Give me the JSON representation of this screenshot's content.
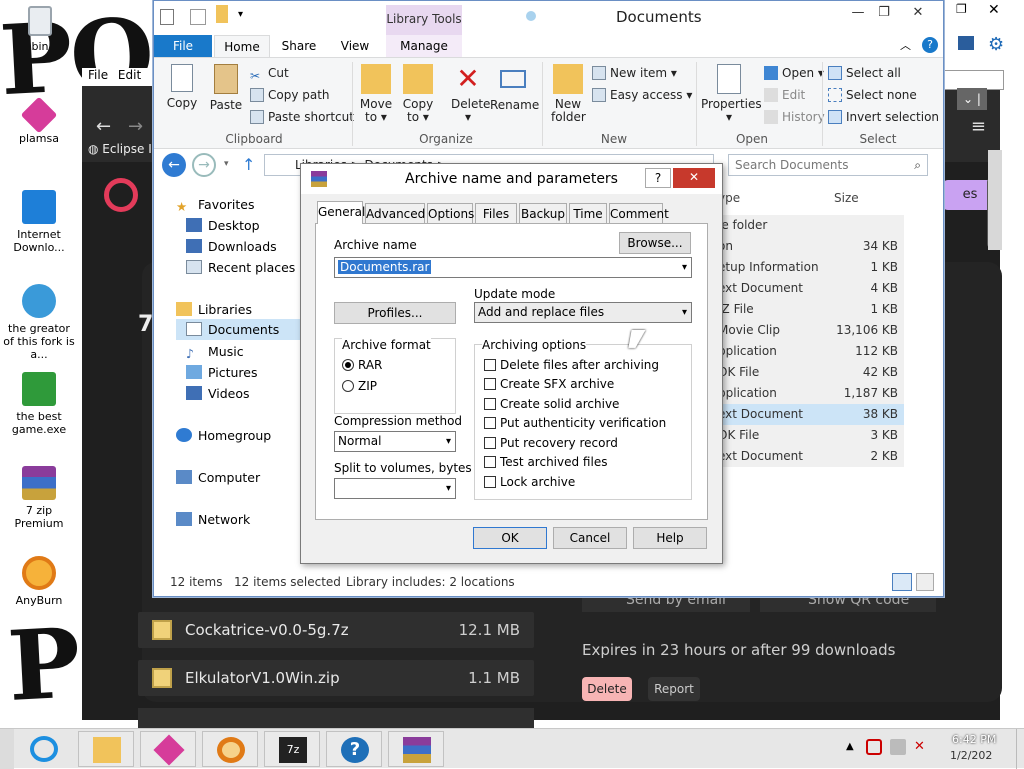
{
  "desktop": {
    "scrawl_top": "PORN",
    "scrawl_bottom": "POR",
    "icons": [
      {
        "label": "bin",
        "icon": "recycle-bin-icon"
      },
      {
        "label": "plamsa",
        "icon": "plasma-icon"
      },
      {
        "label": "Internet Downlo...",
        "icon": "internet-download-icon"
      },
      {
        "label": "the greator of this fork is a...",
        "icon": "shortcut-icon"
      },
      {
        "label": "the best game.exe",
        "icon": "download-arrow-icon"
      },
      {
        "label": "7 zip Premium",
        "icon": "winrar-icon"
      },
      {
        "label": "AnyBurn",
        "icon": "anyburn-icon"
      }
    ]
  },
  "browser": {
    "menu": [
      "File",
      "Edit"
    ],
    "tab_label": "Eclipse I",
    "heading_digit": "7",
    "files": [
      {
        "name": "Cockatrice-v0.0-5g.7z",
        "size": "12.1 MB"
      },
      {
        "name": "ElkulatorV1.0Win.zip",
        "size": "1.1 MB"
      }
    ],
    "send_email": "Send by email",
    "show_qr": "Show QR code",
    "expires": "Expires in 23 hours or after 99 downloads",
    "delete_label": "Delete",
    "report_label": "Report",
    "pill_label": "es"
  },
  "explorer": {
    "title": "Documents",
    "library_tools": "Library Tools",
    "tabs": [
      "File",
      "Home",
      "Share",
      "View",
      "Manage"
    ],
    "clipboard": {
      "copy": "Copy",
      "paste": "Paste",
      "cut": "Cut",
      "copy_path": "Copy path",
      "paste_shortcut": "Paste shortcut",
      "group": "Clipboard"
    },
    "organize": {
      "move_to": "Move to ▾",
      "copy_to": "Copy to ▾",
      "delete": "Delete ▾",
      "rename": "Rename",
      "group": "Organize"
    },
    "new": {
      "new_folder": "New folder",
      "new_item": "New item ▾",
      "easy_access": "Easy access ▾",
      "group": "New"
    },
    "open": {
      "properties": "Properties ▾",
      "open": "Open ▾",
      "edit": "Edit",
      "history": "History",
      "group": "Open"
    },
    "select": {
      "select_all": "Select all",
      "select_none": "Select none",
      "invert": "Invert selection",
      "group": "Select"
    },
    "address": "Libraries > Documents >",
    "search_placeholder": "Search Documents",
    "col_type": "ype",
    "col_size": "Size",
    "nav": {
      "favorites": "Favorites",
      "desktop": "Desktop",
      "downloads": "Downloads",
      "recent": "Recent places",
      "libraries": "Libraries",
      "documents": "Documents",
      "music": "Music",
      "pictures": "Pictures",
      "videos": "Videos",
      "homegroup": "Homegroup",
      "computer": "Computer",
      "network": "Network"
    },
    "rows": [
      {
        "type": "le folder",
        "size": ""
      },
      {
        "type": "on",
        "size": "34 KB"
      },
      {
        "type": "etup Information",
        "size": "1 KB"
      },
      {
        "type": "ext Document",
        "size": "4 KB"
      },
      {
        "type": "IZ File",
        "size": "1 KB"
      },
      {
        "type": "Movie Clip",
        "size": "13,106 KB"
      },
      {
        "type": "pplication",
        "size": "112 KB"
      },
      {
        "type": "OK File",
        "size": "42 KB"
      },
      {
        "type": "pplication",
        "size": "1,187 KB"
      },
      {
        "type": "ext Document",
        "size": "38 KB"
      },
      {
        "type": "OK File",
        "size": "3 KB"
      },
      {
        "type": "ext Document",
        "size": "2 KB"
      }
    ],
    "status": {
      "items": "12 items",
      "selected": "12 items selected",
      "library": "Library includes: 2 locations"
    }
  },
  "dialog": {
    "title": "Archive name and parameters",
    "help_btn": "?",
    "tabs": [
      "General",
      "Advanced",
      "Options",
      "Files",
      "Backup",
      "Time",
      "Comment"
    ],
    "archive_name_label": "Archive name",
    "archive_name_value": "Documents.rar",
    "browse": "Browse...",
    "profiles": "Profiles...",
    "update_mode_label": "Update mode",
    "update_mode_value": "Add and replace files",
    "archive_format_label": "Archive format",
    "format_rar": "RAR",
    "format_zip": "ZIP",
    "compression_label": "Compression method",
    "compression_value": "Normal",
    "split_label": "Split to volumes, bytes",
    "split_value": "",
    "options_label": "Archiving options",
    "options": [
      "Delete files after archiving",
      "Create SFX archive",
      "Create solid archive",
      "Put authenticity verification",
      "Put recovery record",
      "Test archived files",
      "Lock archive"
    ],
    "ok": "OK",
    "cancel": "Cancel",
    "help": "Help"
  },
  "taskbar": {
    "clock_time": "6:42 PM",
    "clock_date": "1/2/202"
  },
  "colors": {
    "accent": "#1979ca",
    "library_tools": "#e8d8f0",
    "selected_row": "#cce4f7",
    "delete_pill": "#f7b4b4"
  }
}
